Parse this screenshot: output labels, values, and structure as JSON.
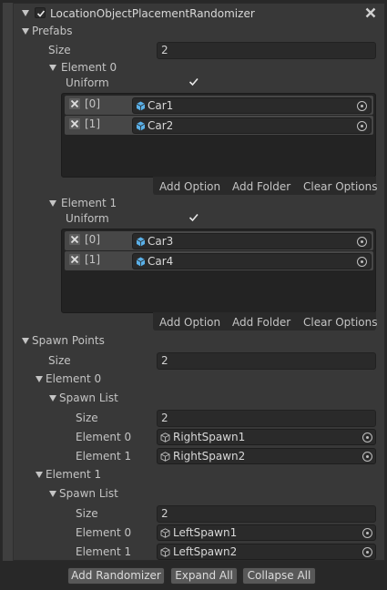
{
  "header": {
    "title": "LocationObjectPlacementRandomizer"
  },
  "prefabs": {
    "label": "Prefabs",
    "size_label": "Size",
    "size_value": "2",
    "elements": [
      {
        "label": "Element 0",
        "uniform_label": "Uniform",
        "uniform_checked": true,
        "items": [
          {
            "index": "[0]",
            "name": "Car1"
          },
          {
            "index": "[1]",
            "name": "Car2"
          }
        ]
      },
      {
        "label": "Element 1",
        "uniform_label": "Uniform",
        "uniform_checked": true,
        "items": [
          {
            "index": "[0]",
            "name": "Car3"
          },
          {
            "index": "[1]",
            "name": "Car4"
          }
        ]
      }
    ],
    "buttons": {
      "add_option": "Add Option",
      "add_folder": "Add Folder",
      "clear_options": "Clear Options"
    }
  },
  "spawn_points": {
    "label": "Spawn Points",
    "size_label": "Size",
    "size_value": "2",
    "elements": [
      {
        "label": "Element 0",
        "list_label": "Spawn List",
        "size_label": "Size",
        "size_value": "2",
        "items": [
          {
            "label": "Element 0",
            "value": "RightSpawn1"
          },
          {
            "label": "Element 1",
            "value": "RightSpawn2"
          }
        ]
      },
      {
        "label": "Element 1",
        "list_label": "Spawn List",
        "size_label": "Size",
        "size_value": "2",
        "items": [
          {
            "label": "Element 0",
            "value": "LeftSpawn1"
          },
          {
            "label": "Element 1",
            "value": "LeftSpawn2"
          }
        ]
      }
    ]
  },
  "footer": {
    "add_randomizer": "Add Randomizer",
    "expand_all": "Expand All",
    "collapse_all": "Collapse All"
  },
  "colors": {
    "panel": "#383838",
    "background": "#282828",
    "field": "#2a2a2a",
    "prefab_icon": "#5ab0e8",
    "text": "#c4c4c4"
  },
  "icons": {
    "fold": "triangle-down-icon",
    "check": "check-icon",
    "remove": "x-icon",
    "prefab": "prefab-cube-icon",
    "gameobject": "gameobject-cube-icon",
    "picker": "object-picker-icon"
  }
}
